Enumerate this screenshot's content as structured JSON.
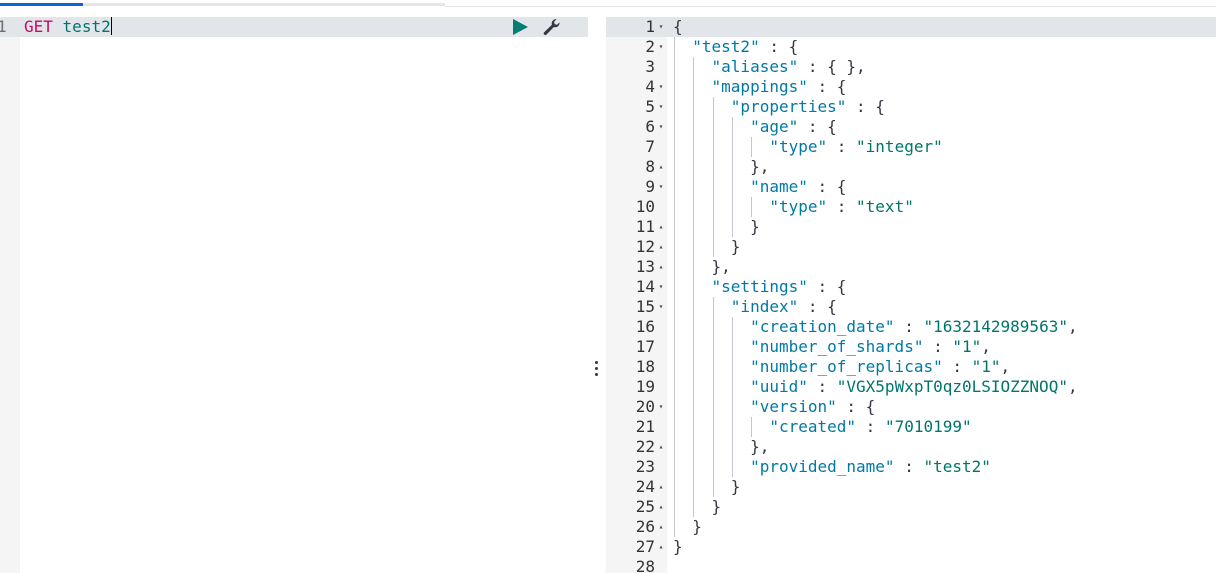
{
  "request": {
    "line_number": "1",
    "method": "GET",
    "path": "test2"
  },
  "toolbar": {
    "run_icon": "play-icon",
    "settings_icon": "wrench-icon",
    "run_color": "#017d73"
  },
  "splitter": {
    "icon": "vertical-ellipsis-icon"
  },
  "response": {
    "lines": [
      {
        "n": "1",
        "fold": "▾",
        "d": 0,
        "t": [
          [
            "{",
            "p"
          ]
        ]
      },
      {
        "n": "2",
        "fold": "▾",
        "d": 1,
        "t": [
          [
            "\"test2\"",
            "k"
          ],
          [
            " : {",
            "p"
          ]
        ]
      },
      {
        "n": "3",
        "fold": "",
        "d": 2,
        "t": [
          [
            "\"aliases\"",
            "k"
          ],
          [
            " : { },",
            "p"
          ]
        ]
      },
      {
        "n": "4",
        "fold": "▾",
        "d": 2,
        "t": [
          [
            "\"mappings\"",
            "k"
          ],
          [
            " : {",
            "p"
          ]
        ]
      },
      {
        "n": "5",
        "fold": "▾",
        "d": 3,
        "t": [
          [
            "\"properties\"",
            "k"
          ],
          [
            " : {",
            "p"
          ]
        ]
      },
      {
        "n": "6",
        "fold": "▾",
        "d": 4,
        "t": [
          [
            "\"age\"",
            "k"
          ],
          [
            " : {",
            "p"
          ]
        ]
      },
      {
        "n": "7",
        "fold": "",
        "d": 5,
        "t": [
          [
            "\"type\"",
            "k"
          ],
          [
            " : ",
            "p"
          ],
          [
            "\"integer\"",
            "s"
          ]
        ]
      },
      {
        "n": "8",
        "fold": "▴",
        "d": 4,
        "t": [
          [
            "},",
            "p"
          ]
        ]
      },
      {
        "n": "9",
        "fold": "▾",
        "d": 4,
        "t": [
          [
            "\"name\"",
            "k"
          ],
          [
            " : {",
            "p"
          ]
        ]
      },
      {
        "n": "10",
        "fold": "",
        "d": 5,
        "t": [
          [
            "\"type\"",
            "k"
          ],
          [
            " : ",
            "p"
          ],
          [
            "\"text\"",
            "s"
          ]
        ]
      },
      {
        "n": "11",
        "fold": "▴",
        "d": 4,
        "t": [
          [
            "}",
            "p"
          ]
        ]
      },
      {
        "n": "12",
        "fold": "▴",
        "d": 3,
        "t": [
          [
            "}",
            "p"
          ]
        ]
      },
      {
        "n": "13",
        "fold": "▴",
        "d": 2,
        "t": [
          [
            "},",
            "p"
          ]
        ]
      },
      {
        "n": "14",
        "fold": "▾",
        "d": 2,
        "t": [
          [
            "\"settings\"",
            "k"
          ],
          [
            " : {",
            "p"
          ]
        ]
      },
      {
        "n": "15",
        "fold": "▾",
        "d": 3,
        "t": [
          [
            "\"index\"",
            "k"
          ],
          [
            " : {",
            "p"
          ]
        ]
      },
      {
        "n": "16",
        "fold": "",
        "d": 4,
        "t": [
          [
            "\"creation_date\"",
            "k"
          ],
          [
            " : ",
            "p"
          ],
          [
            "\"1632142989563\"",
            "s"
          ],
          [
            ",",
            "p"
          ]
        ]
      },
      {
        "n": "17",
        "fold": "",
        "d": 4,
        "t": [
          [
            "\"number_of_shards\"",
            "k"
          ],
          [
            " : ",
            "p"
          ],
          [
            "\"1\"",
            "s"
          ],
          [
            ",",
            "p"
          ]
        ]
      },
      {
        "n": "18",
        "fold": "",
        "d": 4,
        "t": [
          [
            "\"number_of_replicas\"",
            "k"
          ],
          [
            " : ",
            "p"
          ],
          [
            "\"1\"",
            "s"
          ],
          [
            ",",
            "p"
          ]
        ]
      },
      {
        "n": "19",
        "fold": "",
        "d": 4,
        "t": [
          [
            "\"uuid\"",
            "k"
          ],
          [
            " : ",
            "p"
          ],
          [
            "\"VGX5pWxpT0qz0LSIOZZNOQ\"",
            "s"
          ],
          [
            ",",
            "p"
          ]
        ]
      },
      {
        "n": "20",
        "fold": "▾",
        "d": 4,
        "t": [
          [
            "\"version\"",
            "k"
          ],
          [
            " : {",
            "p"
          ]
        ]
      },
      {
        "n": "21",
        "fold": "",
        "d": 5,
        "t": [
          [
            "\"created\"",
            "k"
          ],
          [
            " : ",
            "p"
          ],
          [
            "\"7010199\"",
            "s"
          ]
        ]
      },
      {
        "n": "22",
        "fold": "▴",
        "d": 4,
        "t": [
          [
            "},",
            "p"
          ]
        ]
      },
      {
        "n": "23",
        "fold": "",
        "d": 4,
        "t": [
          [
            "\"provided_name\"",
            "k"
          ],
          [
            " : ",
            "p"
          ],
          [
            "\"test2\"",
            "s"
          ]
        ]
      },
      {
        "n": "24",
        "fold": "▴",
        "d": 3,
        "t": [
          [
            "}",
            "p"
          ]
        ]
      },
      {
        "n": "25",
        "fold": "▴",
        "d": 2,
        "t": [
          [
            "}",
            "p"
          ]
        ]
      },
      {
        "n": "26",
        "fold": "▴",
        "d": 1,
        "t": [
          [
            "}",
            "p"
          ]
        ]
      },
      {
        "n": "27",
        "fold": "▴",
        "d": 0,
        "t": [
          [
            "}",
            "p"
          ]
        ]
      },
      {
        "n": "28",
        "fold": "",
        "d": 0,
        "t": []
      }
    ]
  }
}
